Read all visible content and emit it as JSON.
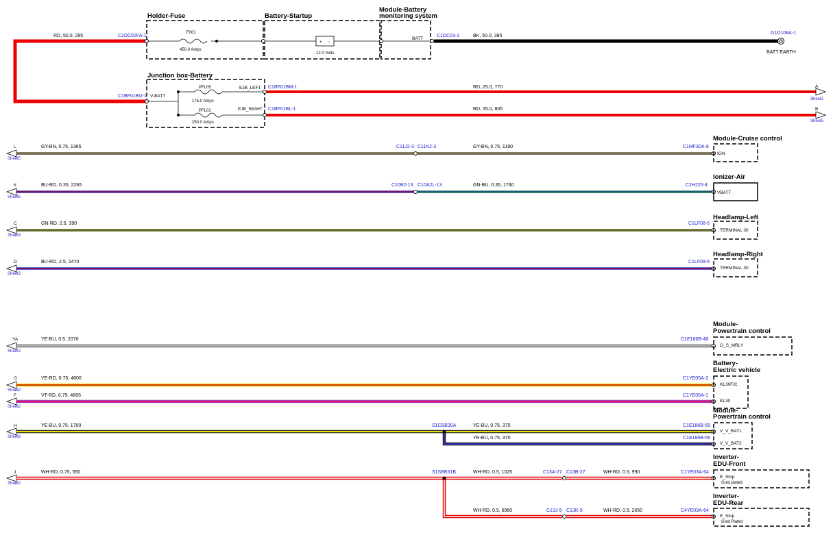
{
  "top_boxes": {
    "holder_fuse": "Holder-Fuse",
    "battery_startup": "Battery-Startup",
    "module_battery_1": "Module-Battery",
    "module_battery_2": "monitoring system",
    "junction_box": "Junction box-Battery"
  },
  "top": {
    "wire_rd_50": "RD, 50.0, 295",
    "conn_c1dc02": "C1DC02FA-1",
    "fuse_f001": "F001",
    "fuse_f001_rating": "450.0 Amps",
    "battery_volts": "12.0 Volts",
    "batt_pin": "BATT",
    "conn_c1dc03": "C1DC03-1",
    "wire_bk_50": "BK, 50.0, 385",
    "conn_g1d108": "G1D108A-1",
    "batt_earth": "BATT EARTH",
    "conn_c1bf01bu": "C1BF01BU-1",
    "vbatt_pin": "V-BATT",
    "pfl05": "PFL05",
    "pfl05_rating": "175.0 Amps",
    "pfl01": "PFL01",
    "pfl01_rating": "250.0 Amps",
    "ejb_left": "EJB_LEFT",
    "ejb_right": "EJB_RIGHT",
    "conn_c1bf01bm": "C1BF01BM-1",
    "conn_c1bf01bl": "C1BF01BL-1",
    "wire_rd_25": "RD, 25.0, 770",
    "wire_rd_35": "RD, 35.0, 805",
    "off_a": "A",
    "off_a_sheet": "Sheet2",
    "off_b": "B",
    "off_b_sheet": "Sheet5"
  },
  "rows": [
    {
      "letter": "L",
      "sheet": "Sheet5",
      "wire1": "GY-BN, 0.75, 1365",
      "conn_a": "C11J2-3",
      "conn_b": "C11K2-3",
      "wire2": "GY-BN, 0.75, 1190",
      "conn_end": "C1MF30A-8",
      "module": "Module-Cruise control",
      "pin": "IGN"
    },
    {
      "letter": "K",
      "sheet": "Sheet5",
      "wire1": "BU-RD, 0.35, 2265",
      "conn_a": "C10B2-13",
      "conn_b": "C10A2L-13",
      "wire2": "GN-BU, 0.35, 1760",
      "conn_end": "C2H220-4",
      "module": "Ionizer-Air",
      "pin": "VBATT"
    },
    {
      "letter": "C",
      "sheet": "Sheet3",
      "wire1": "GN-RD, 2.5, 390",
      "conn_end": "C1LF08-6",
      "module": "Headlamp-Left",
      "pin": "TERMINAL 30"
    },
    {
      "letter": "D",
      "sheet": "Sheet3",
      "wire1": "BU-RD, 2.5, 2470",
      "conn_end": "C1LF09-6",
      "module": "Headlamp-Right",
      "pin": "TERMINAL 30"
    }
  ],
  "lower": {
    "ya_letter": "YA",
    "ya_sheet": "Sheet2",
    "ya_wire": "YE-BU, 0.5, 2070",
    "ya_conn": "C1E186B-48",
    "pt1_title_1": "Module-",
    "pt1_title_2": "Powertrain control",
    "pt1_pin": "O_S_MRLY",
    "g_letter": "G",
    "g_sheet": "Sheet2",
    "g_wire": "YE-RD, 0.75, 4800",
    "g_conn": "C1YE05A-2",
    "f_letter": "F",
    "f_sheet": "Sheet2",
    "f_wire": "VT-RD, 0.75, 4805",
    "f_conn": "C1YE05A-1",
    "bev_title_1": "Battery-",
    "bev_title_2": "Electric vehicle",
    "bev_pin1": "KL30F/C",
    "bev_pin2": "KL30",
    "h_letter": "H",
    "h_sheet": "Sheet3",
    "h_wire": "YE-BU, 0.75, 1700",
    "h_splice": "S1CBB30A",
    "h_wire2": "YE-BU, 0.75, 375",
    "h_conn2": "C1E186B-55",
    "h_wire3": "YE-BU, 0.75, 370",
    "h_conn3": "C1E186B-56",
    "pt2_title_1": "Module-",
    "pt2_title_2": "Powertrain control",
    "pt2_pin1": "V_V_BAT1",
    "pt2_pin2": "V_V_BAT2",
    "j_letter": "J",
    "j_sheet": "Sheet2",
    "j_wire": "WH-RD, 0.75, 550",
    "j_splice": "S1SBB31B",
    "j_wire2": "WH-RD, 0.5, 1025",
    "j_conn_a": "C13A-27",
    "j_conn_b": "C13B-27",
    "j_wire3": "WH-RD, 0.5, 990",
    "j_conn_end": "C1YE03A-64",
    "inv_f_title_1": "Inverter-",
    "inv_f_title_2": "EDU-Front",
    "inv_f_pin": "E_Stop",
    "inv_f_sub": "Gold plated",
    "j_wire4": "WH-RD, 0.5, 6960",
    "j_conn_c": "C13J-5",
    "j_conn_d": "C13K-5",
    "j_wire5": "WH-RD, 0.5, 2050",
    "j_conn_end2": "C4YE03A-64",
    "inv_r_title_1": "Inverter-",
    "inv_r_title_2": "EDU-Rear",
    "inv_r_pin": "E_Stop",
    "inv_r_sub": "Gold Plated"
  }
}
